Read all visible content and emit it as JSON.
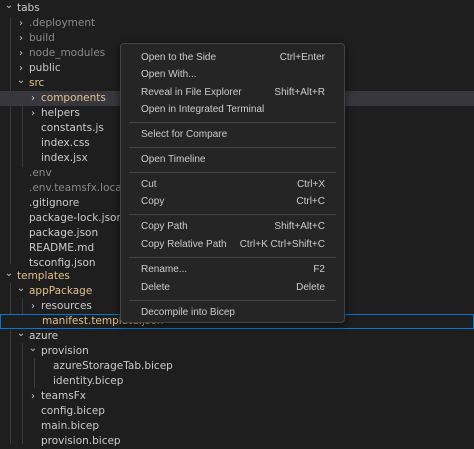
{
  "tree": [
    {
      "label": "tabs",
      "chev": "down"
    },
    {
      "label": ".deployment",
      "chev": "right"
    },
    {
      "label": "build",
      "chev": "right"
    },
    {
      "label": "node_modules",
      "chev": "right"
    },
    {
      "label": "public",
      "chev": "right"
    },
    {
      "label": "src",
      "chev": "down"
    },
    {
      "label": "components",
      "chev": "right"
    },
    {
      "label": "helpers",
      "chev": "right"
    },
    {
      "label": "constants.js"
    },
    {
      "label": "index.css"
    },
    {
      "label": "index.jsx"
    },
    {
      "label": ".env"
    },
    {
      "label": ".env.teamsfx.local"
    },
    {
      "label": ".gitignore"
    },
    {
      "label": "package-lock.json"
    },
    {
      "label": "package.json"
    },
    {
      "label": "README.md"
    },
    {
      "label": "tsconfig.json"
    },
    {
      "label": "templates",
      "chev": "down"
    },
    {
      "label": "appPackage",
      "chev": "down"
    },
    {
      "label": "resources",
      "chev": "right"
    },
    {
      "label": "manifest.template.json"
    },
    {
      "label": "azure",
      "chev": "down"
    },
    {
      "label": "provision",
      "chev": "down"
    },
    {
      "label": "azureStorageTab.bicep"
    },
    {
      "label": "identity.bicep"
    },
    {
      "label": "teamsFx",
      "chev": "right"
    },
    {
      "label": "config.bicep"
    },
    {
      "label": "main.bicep"
    },
    {
      "label": "provision.bicep"
    }
  ],
  "context_menu": [
    {
      "label": "Open to the Side",
      "key": "Ctrl+Enter"
    },
    {
      "label": "Open With...",
      "key": ""
    },
    {
      "label": "Reveal in File Explorer",
      "key": "Shift+Alt+R"
    },
    {
      "label": "Open in Integrated Terminal",
      "key": ""
    },
    {
      "label": "Select for Compare",
      "key": ""
    },
    {
      "label": "Open Timeline",
      "key": ""
    },
    {
      "label": "Cut",
      "key": "Ctrl+X"
    },
    {
      "label": "Copy",
      "key": "Ctrl+C"
    },
    {
      "label": "Copy Path",
      "key": "Shift+Alt+C"
    },
    {
      "label": "Copy Relative Path",
      "key": "Ctrl+K Ctrl+Shift+C"
    },
    {
      "label": "Rename...",
      "key": "F2"
    },
    {
      "label": "Delete",
      "key": "Delete"
    },
    {
      "label": "Decompile into Bicep",
      "key": ""
    }
  ],
  "icons": {
    "expanded": "chevron-down-icon",
    "collapsed": "chevron-right-icon"
  },
  "colors": {
    "folder_git": "#e2c08d",
    "ignored": "#8b8b8b",
    "focus_border": "#0078d4",
    "hover": "#37373d"
  }
}
